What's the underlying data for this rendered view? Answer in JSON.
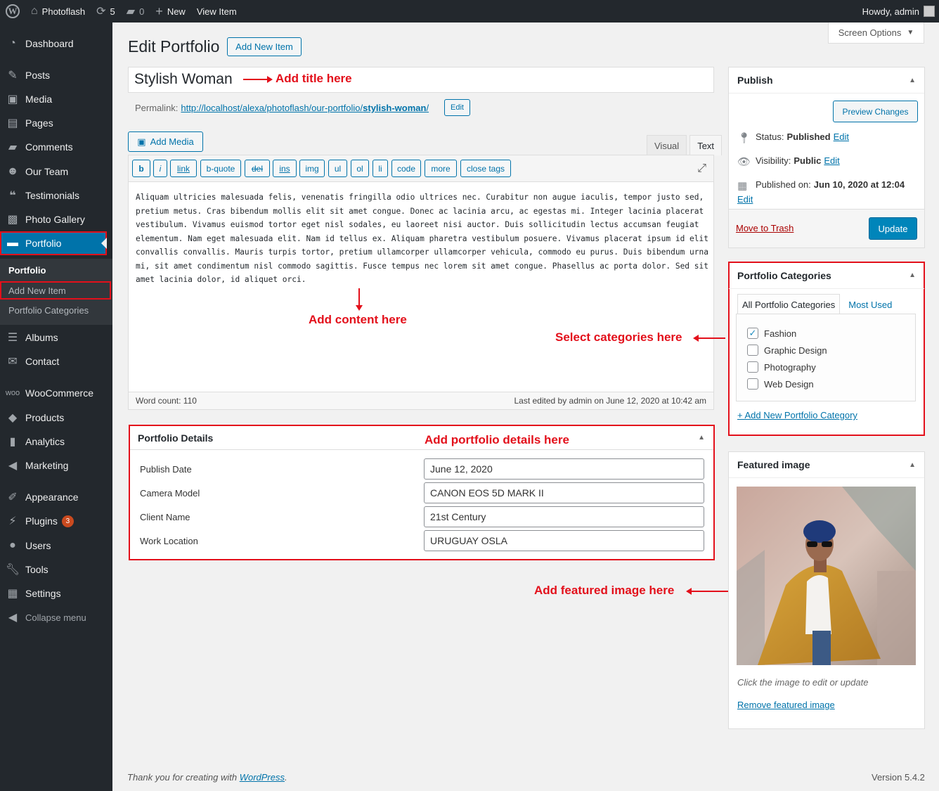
{
  "adminbar": {
    "site_name": "Photoflash",
    "updates_count": "5",
    "comments_count": "0",
    "new_label": "New",
    "view_item_label": "View Item",
    "howdy": "Howdy, admin"
  },
  "sidebar": {
    "items": [
      {
        "label": "Dashboard",
        "icon": "dashboard-icon"
      },
      {
        "label": "Posts",
        "icon": "pin-icon"
      },
      {
        "label": "Media",
        "icon": "media-icon"
      },
      {
        "label": "Pages",
        "icon": "pages-icon"
      },
      {
        "label": "Comments",
        "icon": "comment-icon"
      },
      {
        "label": "Our Team",
        "icon": "team-icon"
      },
      {
        "label": "Testimonials",
        "icon": "quote-icon"
      },
      {
        "label": "Photo Gallery",
        "icon": "gallery-icon"
      },
      {
        "label": "Portfolio",
        "icon": "folder-icon"
      },
      {
        "label": "Albums",
        "icon": "albums-icon"
      },
      {
        "label": "Contact",
        "icon": "mail-icon"
      },
      {
        "label": "WooCommerce",
        "icon": "woo-icon"
      },
      {
        "label": "Products",
        "icon": "box-icon"
      },
      {
        "label": "Analytics",
        "icon": "chart-icon"
      },
      {
        "label": "Marketing",
        "icon": "megaphone-icon"
      },
      {
        "label": "Appearance",
        "icon": "brush-icon"
      },
      {
        "label": "Plugins",
        "icon": "plug-icon",
        "badge": "3"
      },
      {
        "label": "Users",
        "icon": "user-icon"
      },
      {
        "label": "Tools",
        "icon": "wrench-icon"
      },
      {
        "label": "Settings",
        "icon": "settings-icon"
      },
      {
        "label": "Collapse menu",
        "icon": "collapse-icon"
      }
    ],
    "submenu": {
      "head": "Portfolio",
      "add_new": "Add New Item",
      "categories": "Portfolio Categories"
    }
  },
  "header": {
    "title": "Edit Portfolio",
    "add_new_button": "Add New Item",
    "screen_options": "Screen Options"
  },
  "post": {
    "title": "Stylish Woman",
    "permalink_label": "Permalink:",
    "permalink_base": "http://localhost/alexa/photoflash/our-portfolio/",
    "permalink_slug": "stylish-woman",
    "permalink_end": "/",
    "permalink_edit": "Edit"
  },
  "editor": {
    "add_media": "Add Media",
    "tab_visual": "Visual",
    "tab_text": "Text",
    "quicktags": [
      "b",
      "i",
      "link",
      "b-quote",
      "del",
      "ins",
      "img",
      "ul",
      "ol",
      "li",
      "code",
      "more",
      "close tags"
    ],
    "content": "Aliquam ultricies malesuada felis, venenatis fringilla odio ultrices nec. Curabitur non augue iaculis, tempor justo sed, pretium metus. Cras bibendum mollis elit sit amet congue. Donec ac lacinia arcu, ac egestas mi. Integer lacinia placerat vestibulum. Vivamus euismod tortor eget nisl sodales, eu laoreet nisi auctor. Duis sollicitudin lectus accumsan feugiat elementum. Nam eget malesuada elit. Nam id tellus ex. Aliquam pharetra vestibulum posuere. Vivamus placerat ipsum id elit convallis convallis. Mauris turpis tortor, pretium ullamcorper ullamcorper vehicula, commodo eu purus. Duis bibendum urna mi, sit amet condimentum nisl commodo sagittis. Fusce tempus nec lorem sit amet congue. Phasellus ac porta dolor. Sed sit amet lacinia dolor, id aliquet orci.",
    "word_count": "Word count: 110",
    "last_edited": "Last edited by admin on June 12, 2020 at 10:42 am"
  },
  "details": {
    "title": "Portfolio Details",
    "fields": [
      {
        "label": "Publish Date",
        "value": "June 12, 2020"
      },
      {
        "label": "Camera Model",
        "value": "CANON EOS 5D MARK II"
      },
      {
        "label": "Client Name",
        "value": "21st Century"
      },
      {
        "label": "Work Location",
        "value": "URUGUAY OSLA"
      }
    ]
  },
  "annotations": {
    "title": "Add title here",
    "content": "Add content here",
    "details": "Add portfolio details here",
    "categories": "Select categories here",
    "featured": "Add featured image here"
  },
  "publish": {
    "title": "Publish",
    "preview": "Preview Changes",
    "status_label": "Status:",
    "status_value": "Published",
    "visibility_label": "Visibility:",
    "visibility_value": "Public",
    "published_label": "Published on:",
    "published_value": "Jun 10, 2020 at 12:04",
    "edit": "Edit",
    "trash": "Move to Trash",
    "update": "Update"
  },
  "categories": {
    "title": "Portfolio Categories",
    "tab_all": "All Portfolio Categories",
    "tab_used": "Most Used",
    "items": [
      {
        "label": "Fashion",
        "checked": true
      },
      {
        "label": "Graphic Design",
        "checked": false
      },
      {
        "label": "Photography",
        "checked": false
      },
      {
        "label": "Web Design",
        "checked": false
      }
    ],
    "add_new": "+ Add New Portfolio Category"
  },
  "featured": {
    "title": "Featured image",
    "caption": "Click the image to edit or update",
    "remove": "Remove featured image"
  },
  "footer": {
    "thanks_prefix": "Thank you for creating with ",
    "wordpress": "WordPress",
    "thanks_suffix": ".",
    "version": "Version 5.4.2"
  },
  "colors": {
    "accent": "#0073aa",
    "annotation_red": "#e3101b",
    "sidebar_bg": "#23282d",
    "primary_button": "#0085ba"
  }
}
